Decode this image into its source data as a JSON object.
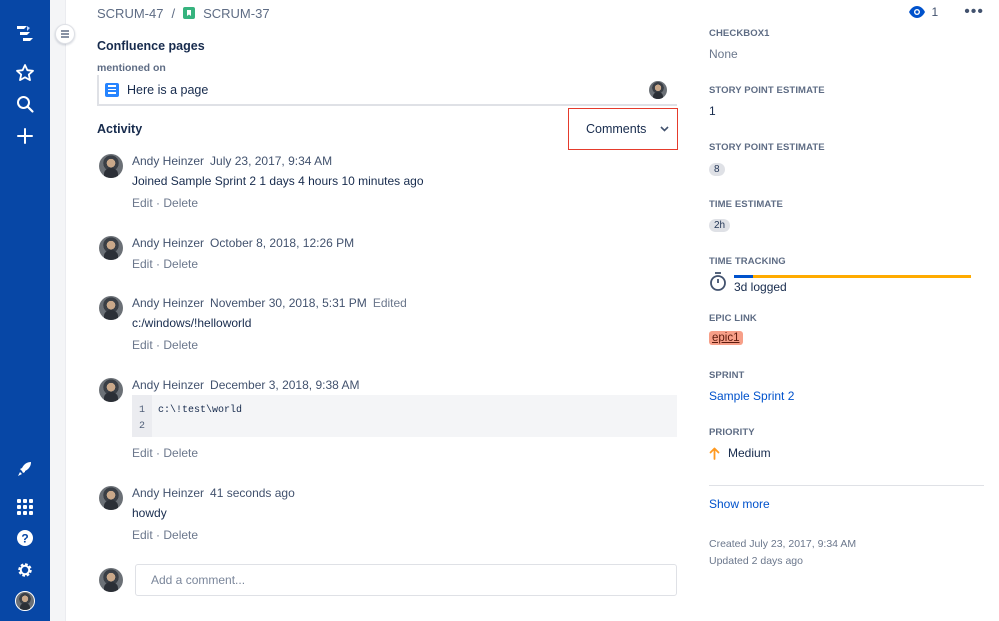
{
  "nav": {
    "items": [
      {
        "name": "jira-logo-icon"
      },
      {
        "name": "star-icon"
      },
      {
        "name": "search-icon"
      },
      {
        "name": "create-icon"
      },
      {
        "name": "rocket-icon"
      },
      {
        "name": "apps-grid-icon"
      },
      {
        "name": "help-icon"
      },
      {
        "name": "settings-icon"
      },
      {
        "name": "profile-avatar"
      }
    ],
    "background": "#0747a6"
  },
  "breadcrumb": {
    "parent": "SCRUM-47",
    "separator": "/",
    "current": "SCRUM-37"
  },
  "confluence": {
    "title": "Confluence pages",
    "subheading": "mentioned on",
    "page": "Here is a page"
  },
  "activity": {
    "title": "Activity",
    "filter_label": "Comments",
    "entries": [
      {
        "author": "Andy Heinzer",
        "time": "July 23, 2017, 9:34 AM",
        "edited": "",
        "body": "Joined Sample Sprint 2 1 days 4 hours 10 minutes ago"
      },
      {
        "author": "Andy Heinzer",
        "time": "October 8, 2018, 12:26 PM",
        "edited": "",
        "body": ""
      },
      {
        "author": "Andy Heinzer",
        "time": "November 30, 2018, 5:31 PM",
        "edited": "Edited",
        "body": "c:/windows/!helloworld"
      },
      {
        "author": "Andy Heinzer",
        "time": "December 3, 2018, 9:38 AM",
        "edited": "",
        "body": "",
        "code": {
          "line_numbers": [
            "1",
            "2"
          ],
          "text": "c:\\!test\\world"
        }
      },
      {
        "author": "Andy Heinzer",
        "time": "41 seconds ago",
        "edited": "",
        "body": "howdy"
      }
    ],
    "edit_label": "Edit",
    "dot": "·",
    "delete_label": "Delete",
    "add_comment_placeholder": "Add a comment..."
  },
  "watch": {
    "count": "1",
    "more": "•••"
  },
  "fields": {
    "checkbox1": {
      "label": "CHECKBOX1",
      "value": "None"
    },
    "story_point_estimate_1": {
      "label": "STORY POINT ESTIMATE",
      "value": "1"
    },
    "story_point_estimate_2": {
      "label": "STORY POINT ESTIMATE",
      "value": "8"
    },
    "time_estimate": {
      "label": "TIME ESTIMATE",
      "value": "2h"
    },
    "time_tracking": {
      "label": "TIME TRACKING",
      "value": "3d logged",
      "logged_fraction": 0.08
    },
    "epic_link": {
      "label": "EPIC LINK",
      "value": "epic1"
    },
    "sprint": {
      "label": "SPRINT",
      "value": "Sample Sprint 2"
    },
    "priority": {
      "label": "PRIORITY",
      "value": "Medium"
    }
  },
  "show_more": "Show more",
  "created": "Created July 23, 2017, 9:34 AM",
  "updated": "Updated 2 days ago",
  "colors": {
    "accent": "#0052cc",
    "highlight_border": "#e53b2c",
    "priority_medium": "#ff991f",
    "tracking_remaining": "#ffab00",
    "epic": "#f79f88"
  }
}
